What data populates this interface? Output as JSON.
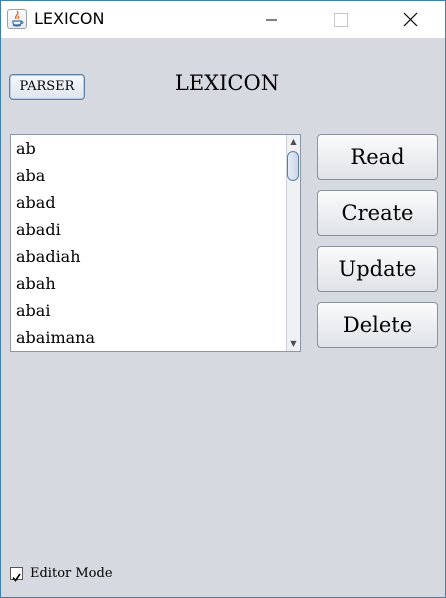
{
  "window": {
    "title": "LEXICON",
    "icon": "java-app-icon",
    "controls": [
      "minimize-icon",
      "maximize-icon",
      "close-icon"
    ]
  },
  "toolbar": {
    "parser_label": "PARSER"
  },
  "heading": "LEXICON",
  "word_list": {
    "items": [
      "ab",
      "aba",
      "abad",
      "abadi",
      "abadiah",
      "abah",
      "abai",
      "abaimana"
    ]
  },
  "actions": {
    "read_label": "Read",
    "create_label": "Create",
    "update_label": "Update",
    "delete_label": "Delete"
  },
  "editor_mode": {
    "label": "Editor Mode",
    "checked": true
  },
  "colors": {
    "window_bg": "#d6d9df",
    "border_accent": "#3c7fb1"
  }
}
